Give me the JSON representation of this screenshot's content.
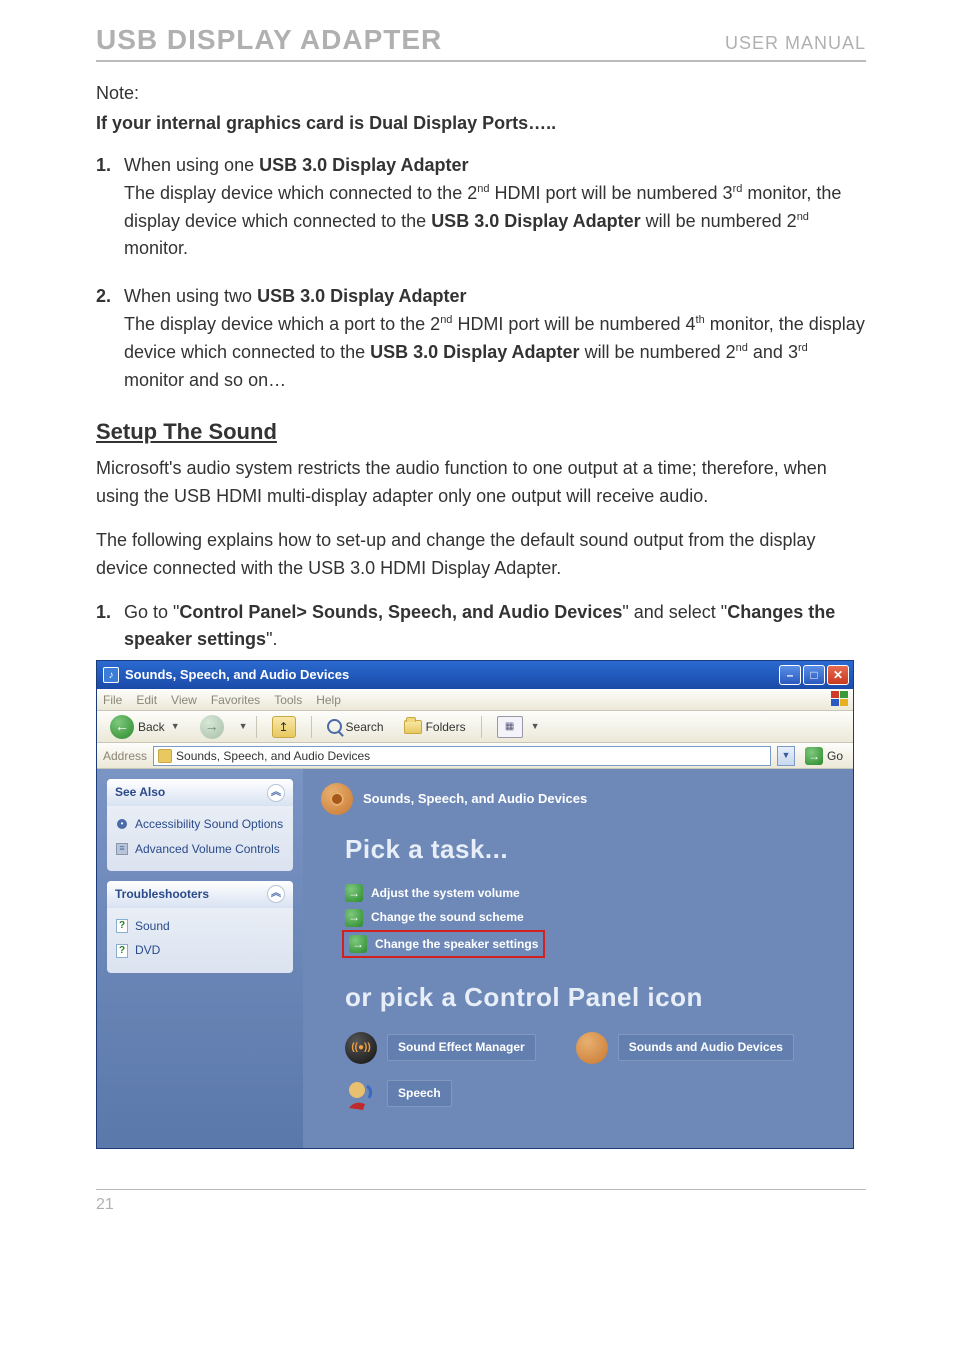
{
  "header": {
    "left": "USB DISPLAY ADAPTER",
    "right": "USER MANUAL"
  },
  "note_label": "Note:",
  "note_bold": "If your internal graphics card is Dual Display Ports…..",
  "item1": {
    "num": "1.",
    "lead": "When using one ",
    "lead_bold": "USB 3.0 Display Adapter",
    "p1a": "The display device which connected to the 2",
    "sup1": "nd",
    "p1b": " HDMI port will be numbered 3",
    "sup2": "rd",
    "p1c": " monitor, the display device which connected to the ",
    "p1_bold": "USB 3.0 Display Adapter",
    "p1d": " will be numbered 2",
    "sup3": "nd",
    "p1e": " monitor."
  },
  "item2": {
    "num": "2.",
    "lead": "When using two ",
    "lead_bold": "USB 3.0 Display Adapter",
    "p1a": "The display device which a port to the 2",
    "sup1": "nd",
    "p1b": " HDMI port will be numbered 4",
    "sup2": "th",
    "p1c": " monitor, the display device which connected to the ",
    "p1_bold": "USB 3.0 Display Adapter",
    "p1d": " will be numbered 2",
    "sup3": "nd",
    "p1e": " and 3",
    "sup4": "rd",
    "p1f": " monitor and so on…"
  },
  "h2": "Setup The Sound",
  "para1": "Microsoft's audio system restricts the audio function to one output at a time; therefore, when using the USB HDMI multi-display adapter only one output will receive audio.",
  "para2": "The following explains how to set-up and change the default sound output from the display device connected with the USB 3.0 HDMI Display Adapter.",
  "step1": {
    "num": "1.",
    "a": "Go to \"",
    "b": "Control Panel> Sounds, Speech, and Audio Devices",
    "c": "\" and select \"",
    "d": "Changes the speaker settings",
    "e": "\"."
  },
  "win": {
    "title": "Sounds, Speech, and Audio Devices",
    "menus": [
      "File",
      "Edit",
      "View",
      "Favorites",
      "Tools",
      "Help"
    ],
    "toolbar": {
      "back": "Back",
      "search": "Search",
      "folders": "Folders"
    },
    "address_label": "Address",
    "address_value": "Sounds, Speech, and Audio Devices",
    "go": "Go",
    "left": {
      "see_also": {
        "title": "See Also",
        "items": [
          "Accessibility Sound Options",
          "Advanced Volume Controls"
        ]
      },
      "troubleshooters": {
        "title": "Troubleshooters",
        "items": [
          "Sound",
          "DVD"
        ]
      }
    },
    "main": {
      "category": "Sounds, Speech, and Audio Devices",
      "pick": "Pick a task...",
      "tasks": [
        "Adjust the system volume",
        "Change the sound scheme",
        "Change the speaker settings"
      ],
      "or_pick": "or pick a Control Panel icon",
      "icons": [
        "Sound Effect Manager",
        "Sounds and Audio Devices",
        "Speech"
      ]
    }
  },
  "page_number": "21"
}
